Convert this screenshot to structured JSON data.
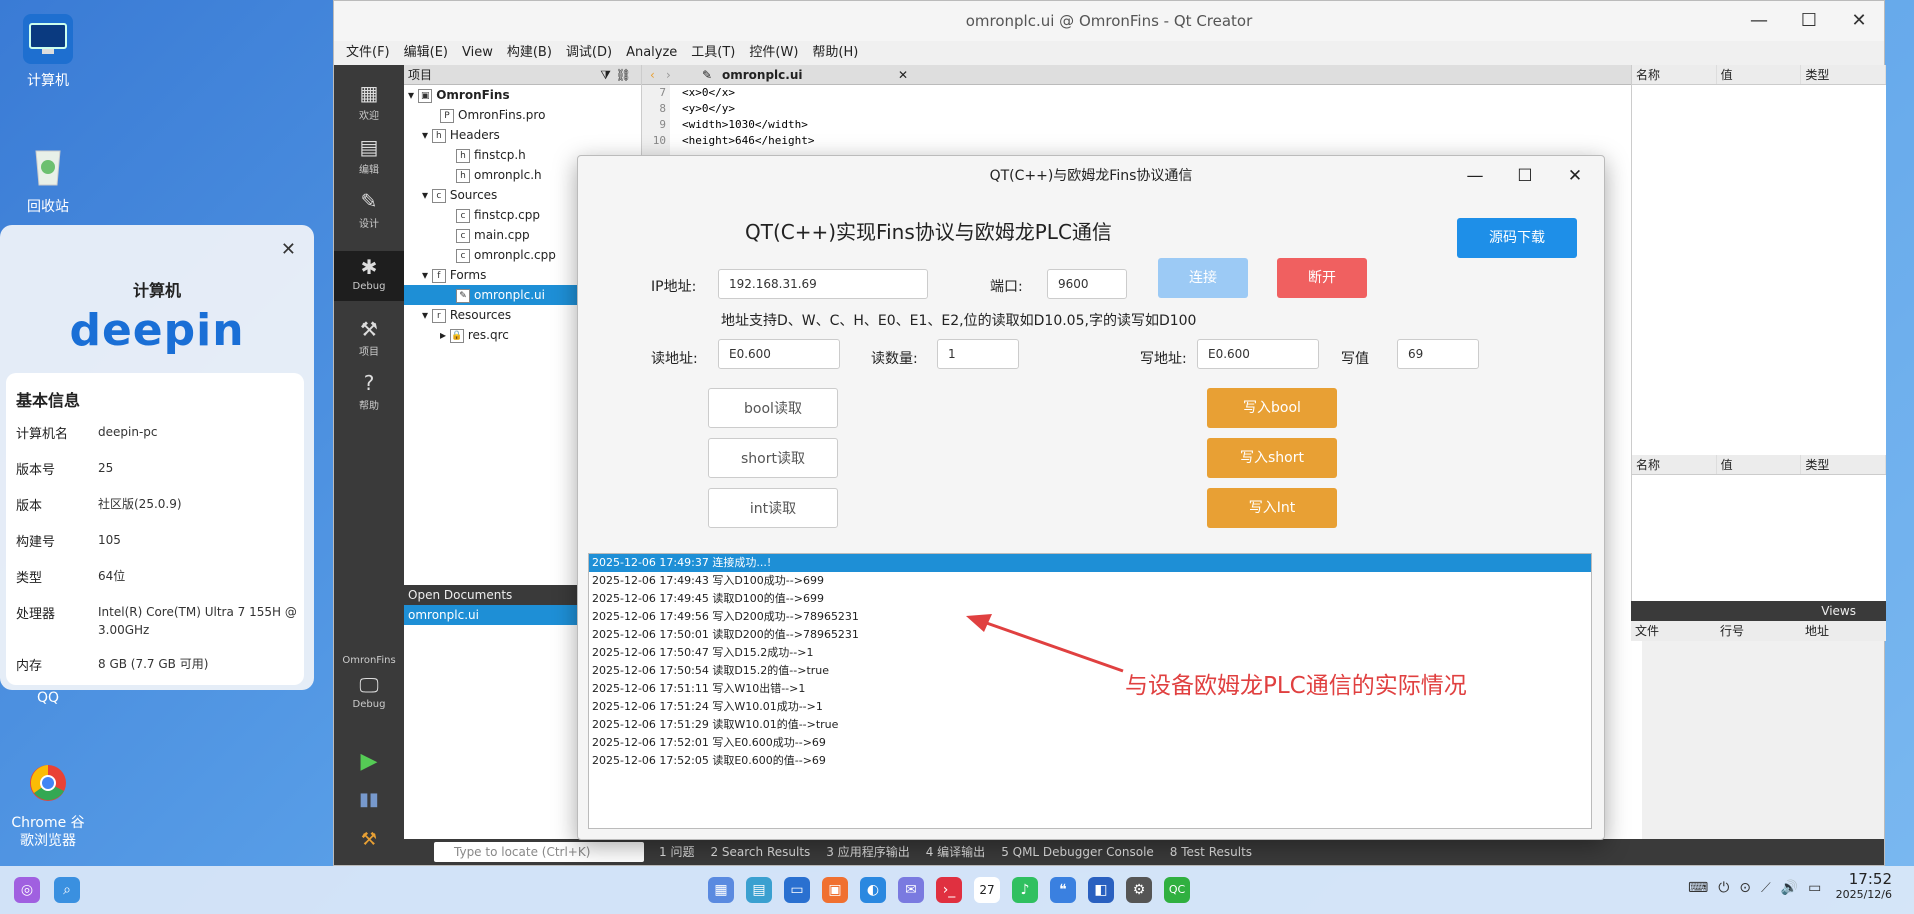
{
  "desktop": {
    "icons": [
      {
        "label": "计算机"
      },
      {
        "label": "回收站"
      },
      {
        "label": "QQ"
      },
      {
        "label": "Chrome 谷\n歌浏览器"
      }
    ]
  },
  "info_panel": {
    "title": "计算机",
    "logo": "deepin",
    "section": "基本信息",
    "rows": [
      {
        "k": "计算机名",
        "v": "deepin-pc"
      },
      {
        "k": "版本号",
        "v": "25"
      },
      {
        "k": "版本",
        "v": "社区版(25.0.9)"
      },
      {
        "k": "构建号",
        "v": "105"
      },
      {
        "k": "类型",
        "v": "64位"
      },
      {
        "k": "处理器",
        "v": "Intel(R) Core(TM) Ultra 7 155H @ 3.00GHz"
      },
      {
        "k": "内存",
        "v": "8 GB (7.7 GB 可用)"
      }
    ]
  },
  "qt": {
    "title": "omronplc.ui @ OmronFins - Qt Creator",
    "menu": [
      "文件(F)",
      "编辑(E)",
      "View",
      "构建(B)",
      "调试(D)",
      "Analyze",
      "工具(T)",
      "控件(W)",
      "帮助(H)"
    ],
    "modes": [
      "欢迎",
      "编辑",
      "设计",
      "Debug",
      "项目",
      "帮助"
    ],
    "kit": {
      "project": "OmronFins",
      "mode": "Debug"
    },
    "project_header": "项目",
    "tree": [
      {
        "label": "OmronFins",
        "indent": 0
      },
      {
        "label": "OmronFins.pro",
        "indent": 1
      },
      {
        "label": "Headers",
        "indent": 1
      },
      {
        "label": "finstcp.h",
        "indent": 2
      },
      {
        "label": "omronplc.h",
        "indent": 2
      },
      {
        "label": "Sources",
        "indent": 1
      },
      {
        "label": "finstcp.cpp",
        "indent": 2
      },
      {
        "label": "main.cpp",
        "indent": 2
      },
      {
        "label": "omronplc.cpp",
        "indent": 2
      },
      {
        "label": "Forms",
        "indent": 1
      },
      {
        "label": "omronplc.ui",
        "indent": 2
      },
      {
        "label": "Resources",
        "indent": 1
      },
      {
        "label": "res.qrc",
        "indent": 2
      }
    ],
    "open_docs_header": "Open Documents",
    "open_doc": "omronplc.ui",
    "editor_file": "omronplc.ui",
    "line_numbers": [
      "7",
      "8",
      "9",
      "10"
    ],
    "code_lines": [
      "<x>0</x>",
      "<y>0</y>",
      "<width>1030</width>",
      "<height>646</height>"
    ],
    "prop_headers": [
      "名称",
      "值",
      "类型"
    ],
    "views_label": "Views",
    "issues_headers": [
      "文件",
      "行号",
      "地址"
    ],
    "locate_placeholder": "Type to locate (Ctrl+K)",
    "output_tabs": [
      "1 问题",
      "2 Search Results",
      "3 应用程序输出",
      "4 编译输出",
      "5 QML Debugger Console",
      "8 Test Results"
    ]
  },
  "dialog": {
    "title": "QT(C++)与欧姆龙Fins协议通信",
    "heading": "QT(C++)实现Fins协议与欧姆龙PLC通信",
    "download_btn": "源码下载",
    "ip_label": "IP地址:",
    "ip_value": "192.168.31.69",
    "port_label": "端口:",
    "port_value": "9600",
    "connect_btn": "连接",
    "disconnect_btn": "断开",
    "hint": "地址支持D、W、C、H、E0、E1、E2,位的读取如D10.05,字的读写如D100",
    "read_addr_label": "读地址:",
    "read_addr_value": "E0.600",
    "read_count_label": "读数量:",
    "read_count_value": "1",
    "write_addr_label": "写地址:",
    "write_addr_value": "E0.600",
    "write_val_label": "写值",
    "write_val_value": "69",
    "read_btns": [
      "bool读取",
      "short读取",
      "int读取"
    ],
    "write_btns": [
      "写入bool",
      "写入short",
      "写入Int"
    ],
    "log": [
      "2025-12-06 17:49:37 连接成功...!",
      "2025-12-06 17:49:43 写入D100成功-->699",
      "2025-12-06 17:49:45 读取D100的值-->699",
      "2025-12-06 17:49:56 写入D200成功-->78965231",
      "2025-12-06 17:50:01 读取D200的值-->78965231",
      "2025-12-06 17:50:47 写入D15.2成功-->1",
      "2025-12-06 17:50:54 读取D15.2的值-->true",
      "2025-12-06 17:51:11 写入W10出错-->1",
      "2025-12-06 17:51:24 写入W10.01成功-->1",
      "2025-12-06 17:51:29 读取W10.01的值-->true",
      "2025-12-06 17:52:01 写入E0.600成功-->69",
      "2025-12-06 17:52:05 读取E0.600的值-->69"
    ],
    "annotation": "与设备欧姆龙PLC通信的实际情况"
  },
  "taskbar": {
    "time": "17:52",
    "date": "2025/12/6",
    "calendar_day": "27"
  },
  "colors": {
    "accent": "#1e8fd6",
    "orange": "#e8a034",
    "red": "#f06060",
    "annotation": "#e04040"
  }
}
